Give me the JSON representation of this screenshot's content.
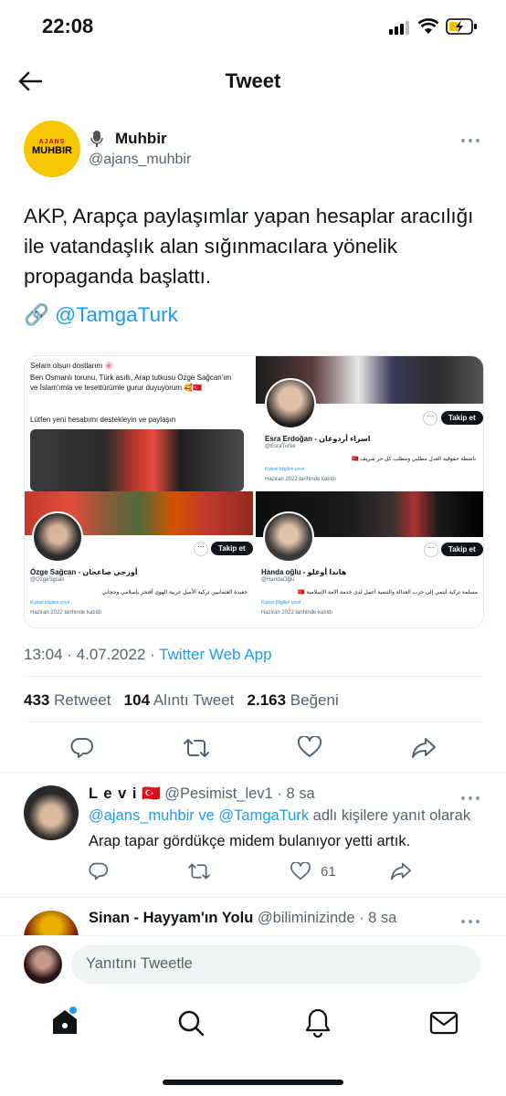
{
  "status_bar": {
    "time": "22:08"
  },
  "header": {
    "title": "Tweet"
  },
  "tweet": {
    "author_name": "Muhbir",
    "author_handle": "@ajans_muhbir",
    "avatar_text_top": "AJANS",
    "avatar_text_main": "MUHBIR",
    "text": "AKP, Arapça paylaşımlar yapan hesaplar aracılığı ile vatandaşlık alan sığınmacılara yönelik propaganda başlattı.",
    "link_emoji": "🔗",
    "link_text": "@TamgaTurk",
    "timestamp": "13:04 · 4.07.2022 · ",
    "source": "Twitter Web App",
    "stats": {
      "retweets": "433",
      "retweets_label": "Retweet",
      "quotes": "104",
      "quotes_label": "Alıntı Tweet",
      "likes": "2.163",
      "likes_label": "Beğeni"
    }
  },
  "media": {
    "panel1": {
      "line1": "Selam olsun dostlarım 🌸",
      "line2": " Ben Osmanlı torunu, Türk asıllı, Arap tutkusu Özge Sağcan'ım ve İslam'ımla ve tesettürümle gurur duyuyorum 🥰🇹🇷",
      "line3": "Lütfen yeni hesabımı destekleyin ve paylaşın"
    },
    "panel2": {
      "name": "Esra Erdoğan - اسراء أردوغان",
      "handle": "@EsraTurke",
      "bio": "ناشطة حقوقية العدل مطلبي ومطلب كل حر شريف 🇹🇷",
      "translate": "Kişisel bilgileri çevir",
      "joined": "Haziran 2022 tarihinde katıldı",
      "follow": "Takip et"
    },
    "panel3": {
      "name": "Özge Sağcan - أوزجي صاغجان",
      "handle": "@OzgeSgcan",
      "bio": "حفيدة العثمانيين تركية الأصل عربية الهوى أفتخر بإسلامي وحجابي",
      "translate": "Kişisel bilgileri çevir",
      "joined": "Haziran 2022 tarihinde katıldı",
      "follow": "Takip et"
    },
    "panel4": {
      "name": "Handa oğlu - هاندا أوغلو",
      "handle": "@HandaOğlu",
      "bio": "مسلمة تركية أنتمي إلى حزب العدالة والتنمية أعمل لدى خدمة الأمة الإسلامية 🇹🇷",
      "translate": "Kişisel bilgileri çevir",
      "joined": "Haziran 2022 tarihinde katıldı",
      "follow": "Takip et"
    }
  },
  "reply1": {
    "name": "L e v i",
    "flag": "🇹🇷",
    "handle": "@Pesimist_lev1",
    "time": "· 8 sa",
    "reply_to_mentions": "@ajans_muhbir ve @TamgaTurk",
    "reply_to_suffix": " adlı kişilere yanıt olarak",
    "text": "Arap tapar gördükçe midem bulanıyor yetti artık.",
    "likes": "61"
  },
  "reply2": {
    "name": "Sinan - Hayyam'ın Yolu",
    "handle": "@biliminizinde",
    "time": "· 8 sa"
  },
  "composer": {
    "placeholder": "Yanıtını Tweetle"
  },
  "colors": {
    "accent": "#1d9bf0",
    "text": "#0f1419",
    "muted": "#536471"
  },
  "icons": [
    "back-arrow-icon",
    "more-icon",
    "reply-icon",
    "retweet-icon",
    "like-icon",
    "share-icon",
    "home-icon",
    "search-icon",
    "notifications-icon",
    "messages-icon"
  ]
}
